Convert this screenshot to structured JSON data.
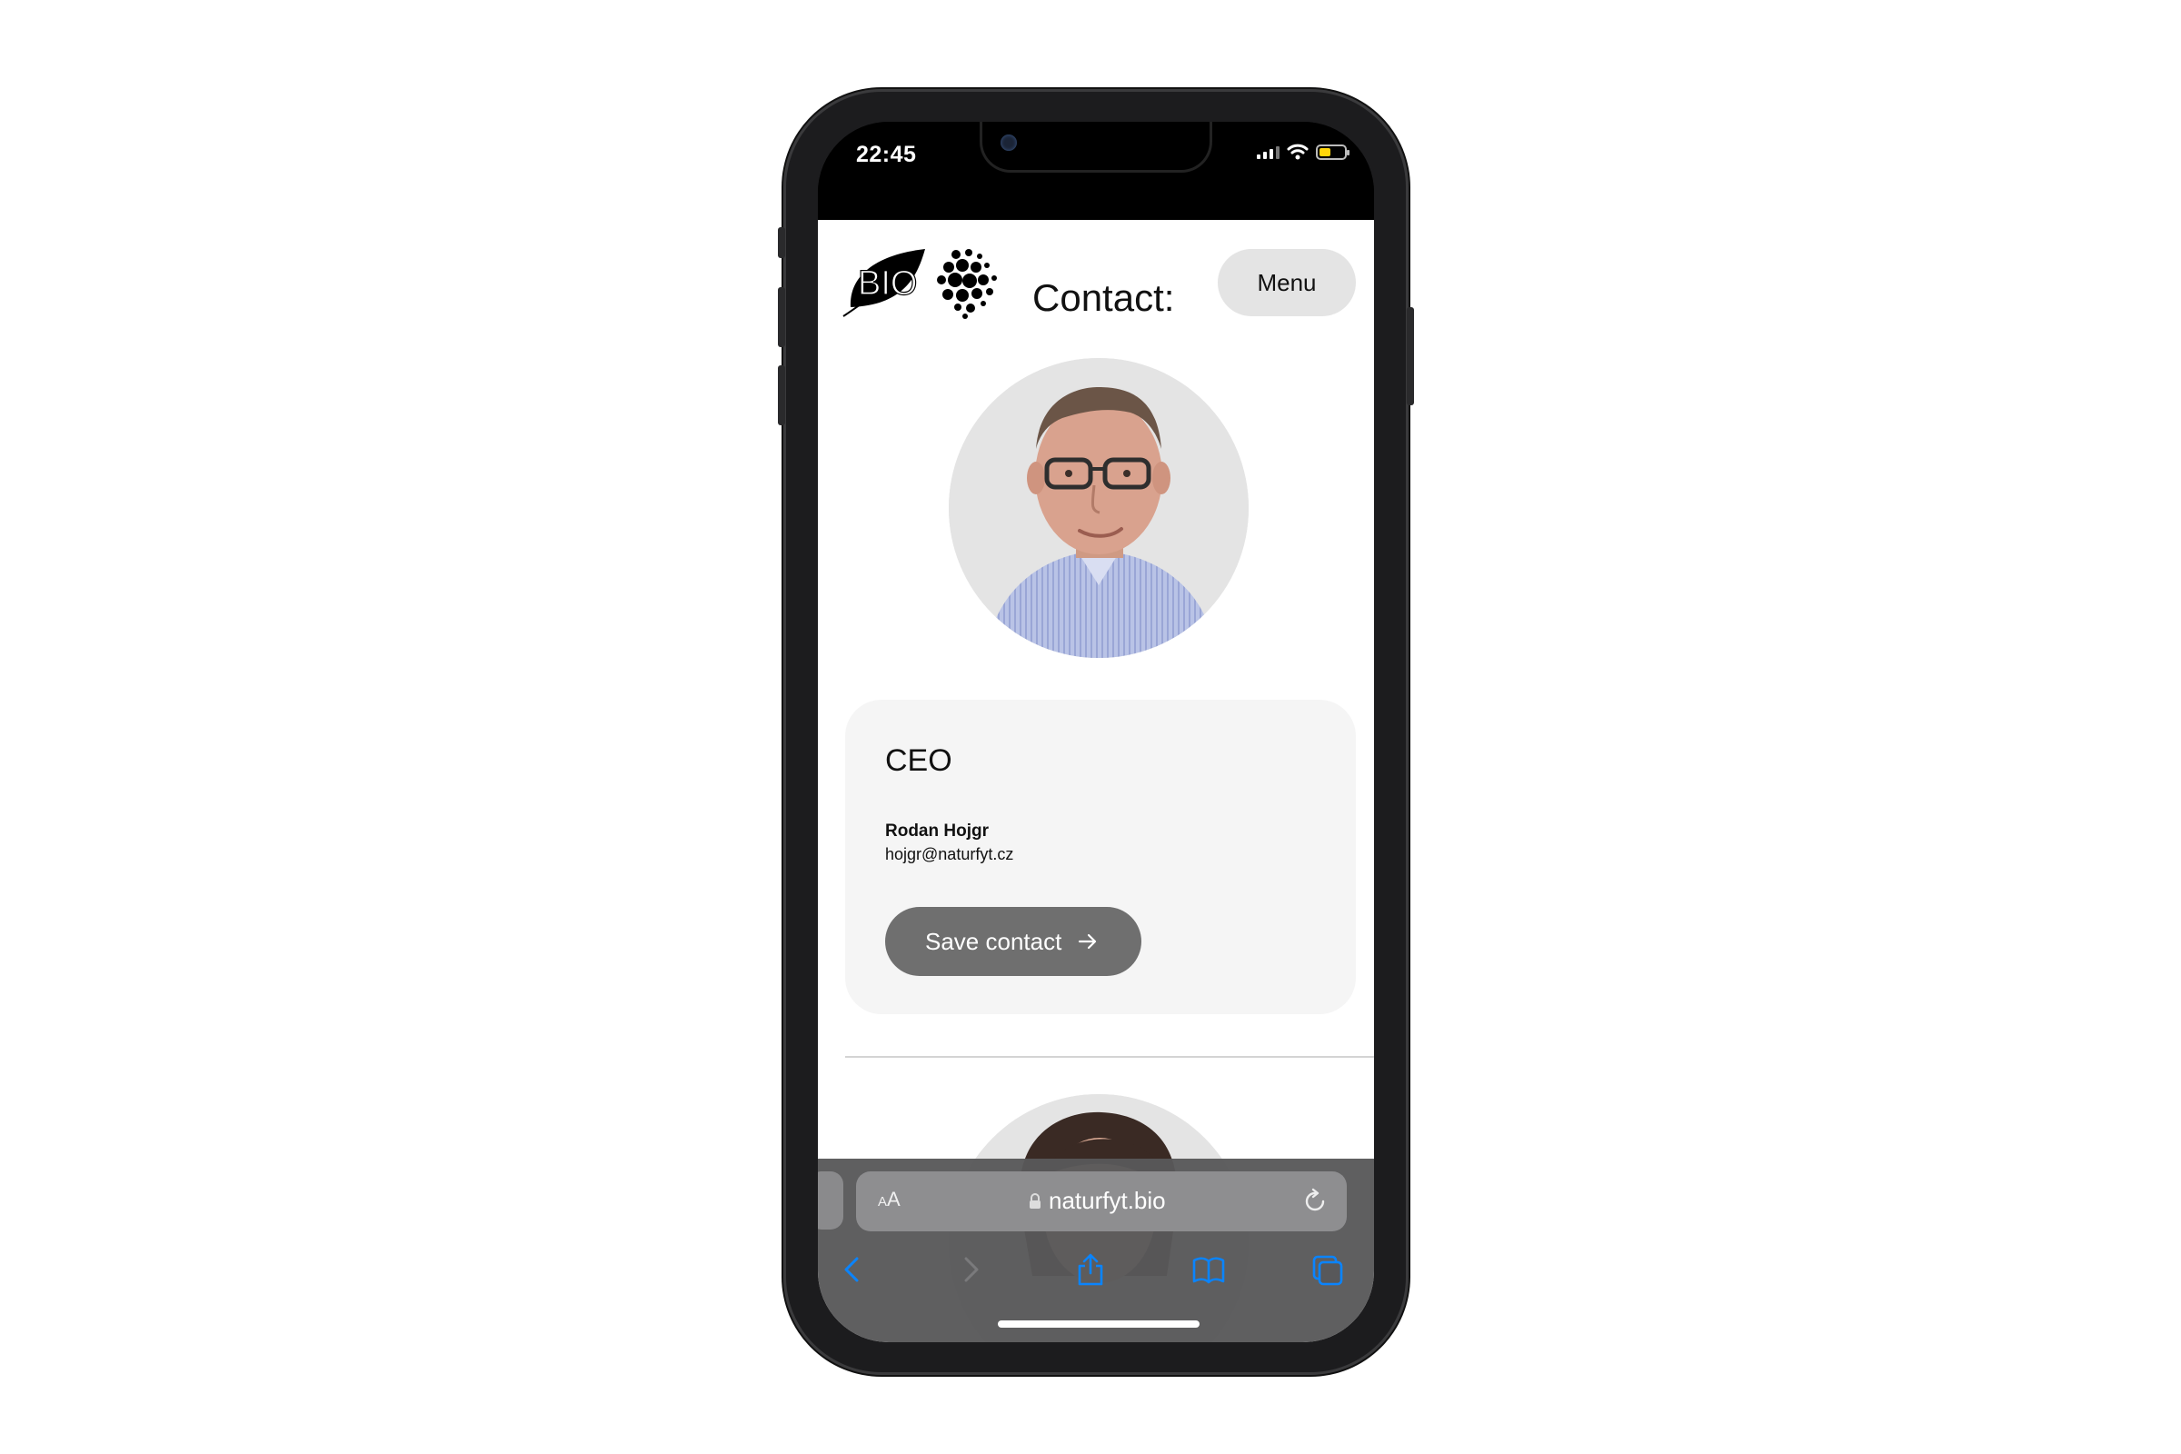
{
  "status_bar": {
    "time": "22:45"
  },
  "header": {
    "logo_text": "BIO",
    "title": "Contact:",
    "menu_label": "Menu"
  },
  "contact": {
    "role": "CEO",
    "name": "Rodan Hojgr",
    "email": "hojgr@naturfyt.cz",
    "save_label": "Save contact"
  },
  "browser": {
    "aa_label_small": "A",
    "aa_label": "A",
    "url": "naturfyt.bio"
  },
  "colors": {
    "accent_button": "#6f6f6f",
    "menu_button": "#e4e4e4",
    "card_background": "#f5f5f5",
    "toolbar_icon": "#0a84ff",
    "battery": "#ffd60a"
  },
  "icons": {
    "back": "chevron-left-icon",
    "forward": "chevron-right-icon",
    "share": "share-icon",
    "bookmarks": "book-icon",
    "tabs": "tabs-icon",
    "reload": "reload-icon",
    "lock": "lock-icon",
    "arrow": "arrow-right-icon"
  }
}
